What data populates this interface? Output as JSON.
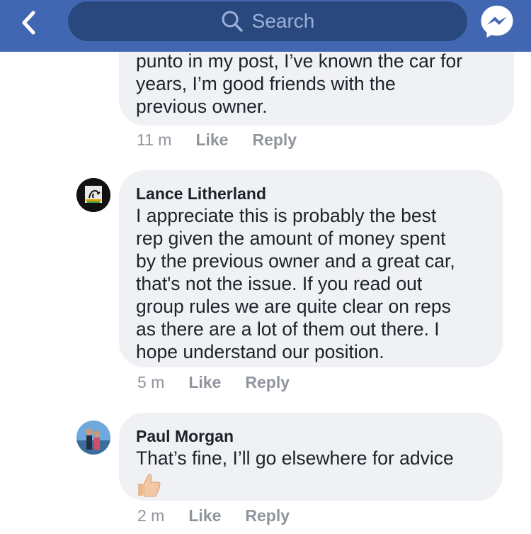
{
  "header": {
    "search_placeholder": "Search"
  },
  "comments": [
    {
      "text": "punto in my post, I’ve known the car for\nyears, I’m good friends with the\nprevious owner.",
      "time": "11 m",
      "like": "Like",
      "reply": "Reply"
    },
    {
      "author": "Lance Litherland",
      "text": "I appreciate this is probably the best\nrep given the amount of money spent\nby the previous owner and a great car,\nthat's not the issue. If you read out\ngroup rules we are quite clear on reps\nas there are a lot of them out there. I\nhope understand our position.",
      "time": "5 m",
      "like": "Like",
      "reply": "Reply"
    },
    {
      "author": "Paul Morgan",
      "text": "That’s fine, I’ll go elsewhere for advice",
      "emoji": "thumbs-up",
      "time": "2 m",
      "like": "Like",
      "reply": "Reply"
    }
  ],
  "colors": {
    "header_bg": "#4267b2",
    "search_bg": "#29487d",
    "bubble_bg": "#f0f1f4",
    "meta_text": "#90949c"
  }
}
